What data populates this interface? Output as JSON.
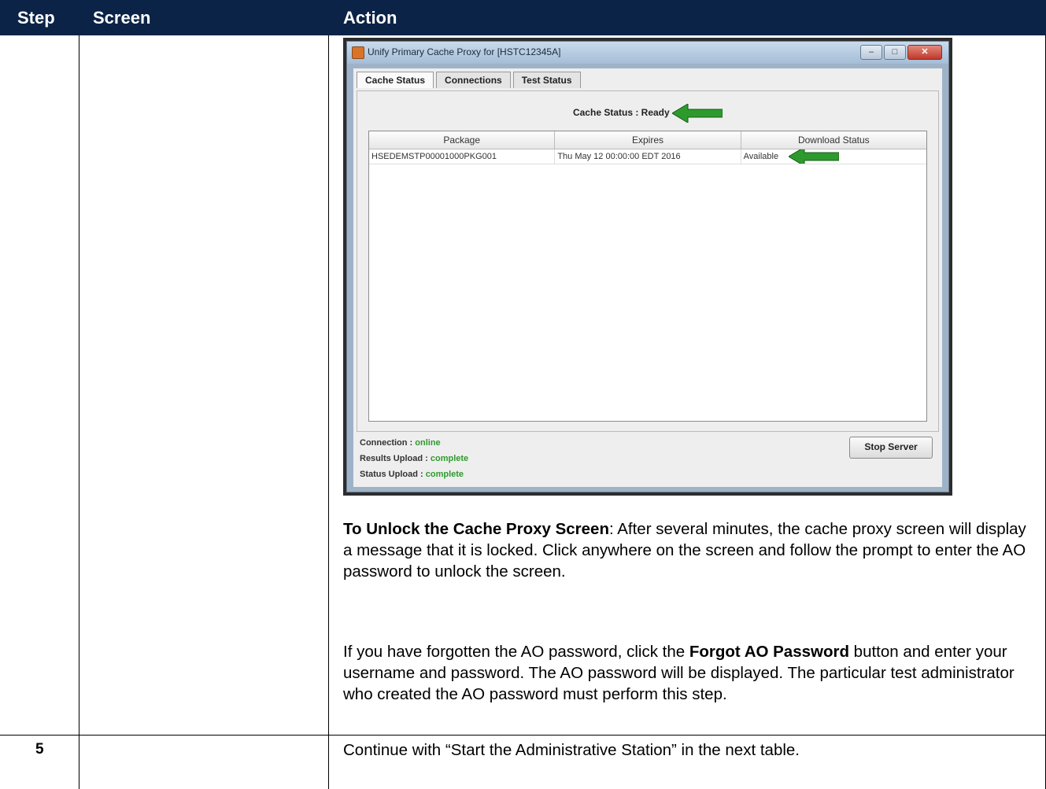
{
  "table": {
    "headers": {
      "step": "Step",
      "screen": "Screen",
      "action": "Action"
    },
    "rows": [
      {
        "step": ""
      },
      {
        "step": "5",
        "action": "Continue with “Start the Administrative Station” in the next table."
      }
    ]
  },
  "screenshot": {
    "window_title": "Unify Primary Cache Proxy for [HSTC12345A]",
    "tabs": [
      "Cache Status",
      "Connections",
      "Test Status"
    ],
    "cache_status": "Cache Status : Ready",
    "grid": {
      "columns": [
        "Package",
        "Expires",
        "Download Status"
      ],
      "rows": [
        [
          "HSEDEMSTP00001000PKG001",
          "Thu May 12 00:00:00 EDT 2016",
          "Available"
        ]
      ]
    },
    "connection_label": "Connection :",
    "connection_value": "online",
    "results_upload_label": "Results Upload :",
    "results_upload_value": "complete",
    "status_upload_label": "Status Upload :",
    "status_upload_value": "complete",
    "stop_button": "Stop Server",
    "arrow_color": "#2e9a2e"
  },
  "instructions": {
    "unlock_heading": "To Unlock the Cache Proxy Screen",
    "unlock_text": ": After several minutes, the cache proxy screen will display a message that it is locked. Click anywhere on the screen and follow the prompt to enter the AO password to unlock the screen.",
    "forgot_text_1": "If you have forgotten the AO password, click the ",
    "forgot_button": "Forgot AO Password",
    "forgot_text_2": " button and enter your username and password. The AO password will be displayed. The particular test administrator who created the AO password must perform this step."
  }
}
